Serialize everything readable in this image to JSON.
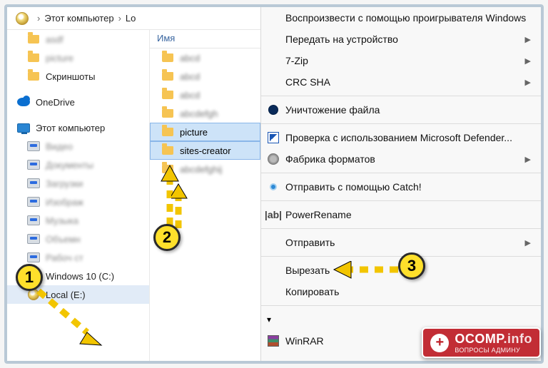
{
  "breadcrumb": {
    "this_pc": "Этот компьютер",
    "drive_cut": "Lo"
  },
  "list_header": "Имя",
  "tree": {
    "blurred": [
      "—",
      "—"
    ],
    "screenshots": "Скриншоты",
    "onedrive": "OneDrive",
    "this_pc": "Этот компьютер",
    "blurred_items": [
      "—",
      "—",
      "—",
      "—",
      "—",
      "—"
    ],
    "winc": "Windows 10 (C:)",
    "local": "Local (E:)"
  },
  "files": {
    "blurred_top": [
      "—",
      "—",
      "—",
      "—"
    ],
    "picture": "picture",
    "sites": "sites-creator",
    "blurred_bot": [
      "—"
    ]
  },
  "menu": {
    "play": "Воспроизвести с помощью проигрывателя Windows",
    "cast": "Передать на устройство",
    "zip": "7-Zip",
    "crc": "CRC SHA",
    "shred": "Уничтожение файла",
    "defender": "Проверка с использованием Microsoft Defender...",
    "factory": "Фабрика форматов",
    "catch": "Отправить с помощью Catch!",
    "powerrename": "PowerRename",
    "send": "Отправить",
    "cut": "Вырезать",
    "copy": "Копировать",
    "winrar": "WinRAR"
  },
  "annotations": {
    "b1": "1",
    "b2": "2",
    "b3": "3"
  },
  "watermark": {
    "brand_a": "OCOMP",
    "brand_b": ".info",
    "tagline": "ВОПРОСЫ АДМИНУ"
  }
}
